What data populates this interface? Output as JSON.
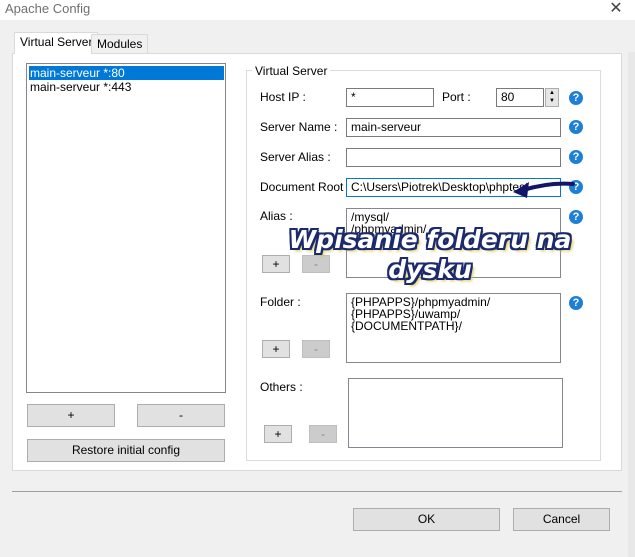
{
  "window": {
    "title": "Apache Config"
  },
  "tabs": [
    {
      "label": "Virtual Server",
      "active": true
    },
    {
      "label": "Modules",
      "active": false
    }
  ],
  "vhost_list": {
    "items": [
      {
        "label": "main-serveur *:80",
        "selected": true
      },
      {
        "label": "main-serveur *:443",
        "selected": false
      }
    ],
    "add_label": "+",
    "remove_label": "-",
    "restore_label": "Restore initial config"
  },
  "virtual_server": {
    "group_title": "Virtual Server",
    "host_ip": {
      "label": "Host IP :",
      "value": "*"
    },
    "port": {
      "label": "Port :",
      "value": "80"
    },
    "server_name": {
      "label": "Server Name :",
      "value": "main-serveur"
    },
    "server_alias": {
      "label": "Server Alias :",
      "value": ""
    },
    "document_root": {
      "label": "Document Root :",
      "value": "C:\\Users\\Piotrek\\Desktop\\phptest"
    },
    "alias": {
      "label": "Alias :",
      "value": "/mysql/\n/phpmyadmin/\n/uwamp",
      "add_label": "+",
      "remove_label": "-"
    },
    "folder": {
      "label": "Folder :",
      "value": "{PHPAPPS}/phpmyadmin/\n{PHPAPPS}/uwamp/\n{DOCUMENTPATH}/",
      "add_label": "+",
      "remove_label": "-"
    },
    "others": {
      "label": "Others :",
      "value": "",
      "add_label": "+",
      "remove_label": "-"
    },
    "help_glyph": "?"
  },
  "footer": {
    "ok_label": "OK",
    "cancel_label": "Cancel"
  },
  "annotation": {
    "line1": "Wpisanie folderu na",
    "line2": "dysku"
  },
  "colors": {
    "selection": "#0078d7",
    "help_icon": "#1e7fd6",
    "annotation_arrow": "#12166b"
  }
}
